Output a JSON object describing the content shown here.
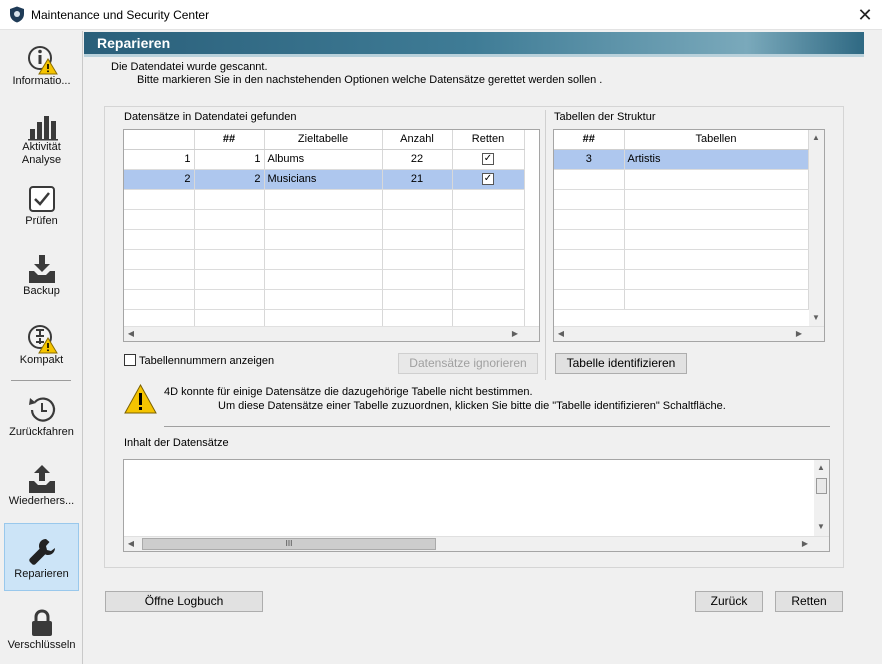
{
  "window": {
    "title": "Maintenance und Security Center",
    "close_label": "✕"
  },
  "sidebar": {
    "items": [
      {
        "label": "Informatio...",
        "icon": "info-warning-icon"
      },
      {
        "label": "Aktivität Analyse",
        "icon": "activity-chart-icon"
      },
      {
        "label": "Prüfen",
        "icon": "verify-check-icon"
      },
      {
        "label": "Backup",
        "icon": "backup-icon"
      },
      {
        "label": "Kompakt",
        "icon": "compact-warning-icon"
      },
      {
        "label": "Zurückfahren",
        "icon": "rollback-icon"
      },
      {
        "label": "Wiederhers...",
        "icon": "restore-icon"
      },
      {
        "label": "Reparieren",
        "icon": "wrench-icon",
        "active": true
      },
      {
        "label": "Verschlüsseln",
        "icon": "lock-icon"
      }
    ]
  },
  "header": {
    "title": "Reparieren"
  },
  "intro": {
    "line1": "Die Datendatei wurde gescannt.",
    "line2": "Bitte markieren Sie in den nachstehenden Optionen welche Datensätze gerettet werden sollen ."
  },
  "records": {
    "label": "Datensätze in Datendatei gefunden",
    "columns": [
      "",
      "##",
      "Zieltabelle",
      "Anzahl",
      "Retten"
    ],
    "rows": [
      {
        "idx": "1",
        "num": "1",
        "table": "Albums",
        "count": "22",
        "checked": "✓"
      },
      {
        "idx": "2",
        "num": "2",
        "table": "Musicians",
        "count": "21",
        "checked": "✓"
      }
    ]
  },
  "structure": {
    "label": "Tabellen der Struktur",
    "columns": [
      "##",
      "Tabellen"
    ],
    "rows": [
      {
        "num": "3",
        "name": "Artistis"
      }
    ]
  },
  "options": {
    "show_numbers_label": "Tabellennummern anzeigen"
  },
  "buttons": {
    "ignore": "Datensätze ignorieren",
    "identify": "Tabelle identifizieren",
    "open_log": "Öffne Logbuch",
    "back": "Zurück",
    "rescue": "Retten"
  },
  "warning": {
    "line1": "4D konnte für einige Datensätze die dazugehörige Tabelle nicht bestimmen.",
    "line2": "Um diese Datensätze einer Tabelle zuzuordnen, klicken Sie bitte die \"Tabelle identifizieren\" Schaltfläche."
  },
  "content": {
    "label": "Inhalt der Datensätze",
    "hscroll_grip": "III"
  },
  "colors": {
    "selection": "#aec7ee",
    "header_bar": "#2a5f7a",
    "active_nav": "#cce4f7"
  }
}
